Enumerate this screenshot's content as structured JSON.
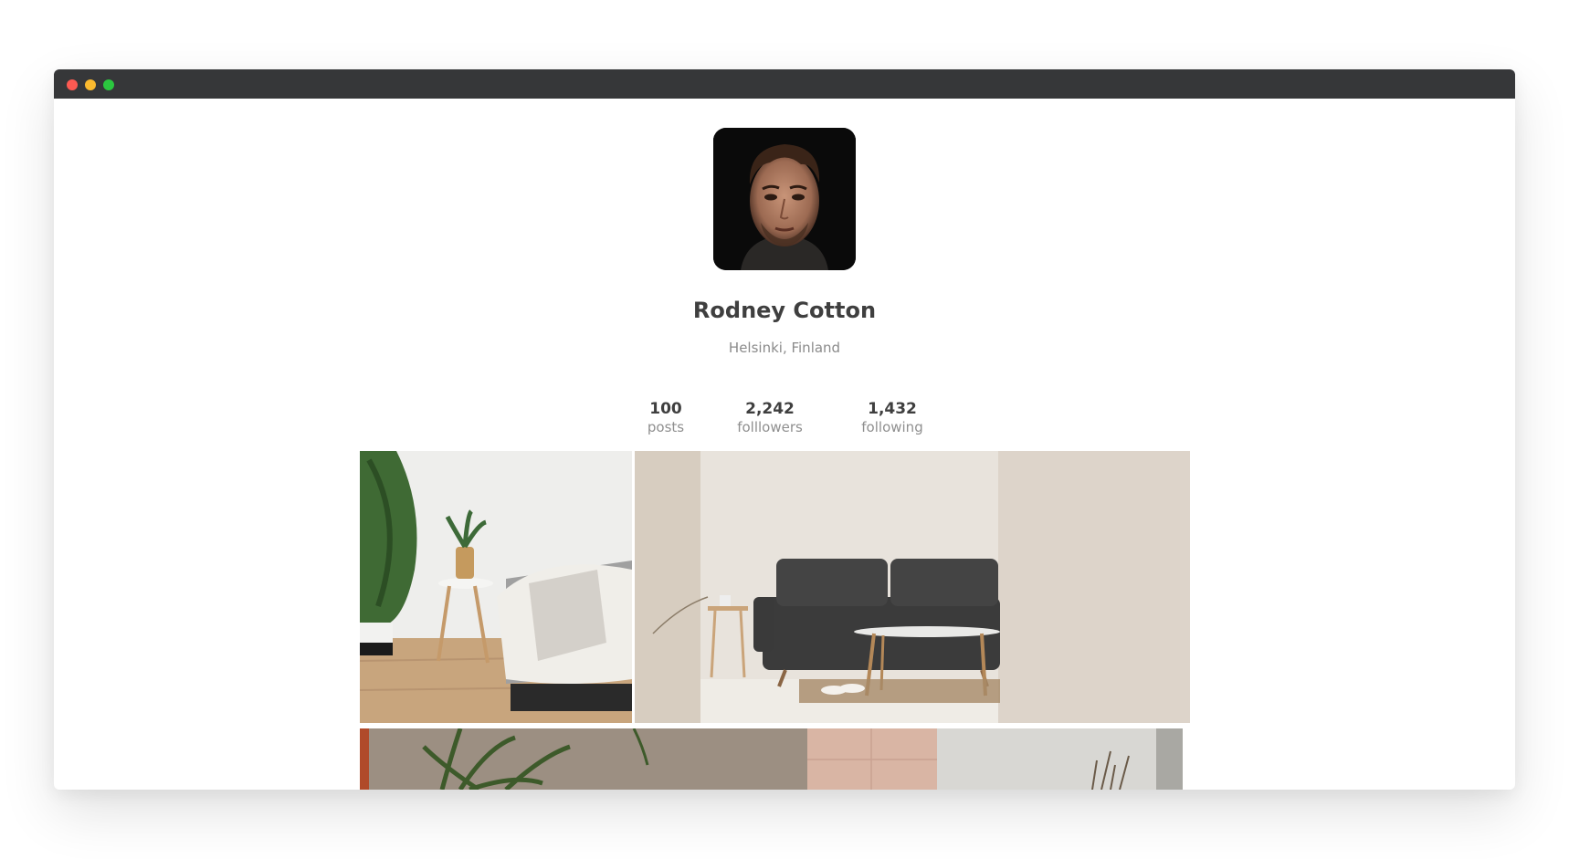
{
  "profile": {
    "name": "Rodney Cotton",
    "location": "Helsinki, Finland"
  },
  "stats": [
    {
      "value": "100",
      "label": "posts"
    },
    {
      "value": "2,242",
      "label": "folllowers"
    },
    {
      "value": "1,432",
      "label": "following"
    }
  ],
  "window_controls": {
    "close_color": "#fd5a52",
    "minimize_color": "#fbba2f",
    "maximize_color": "#2bc73f"
  }
}
